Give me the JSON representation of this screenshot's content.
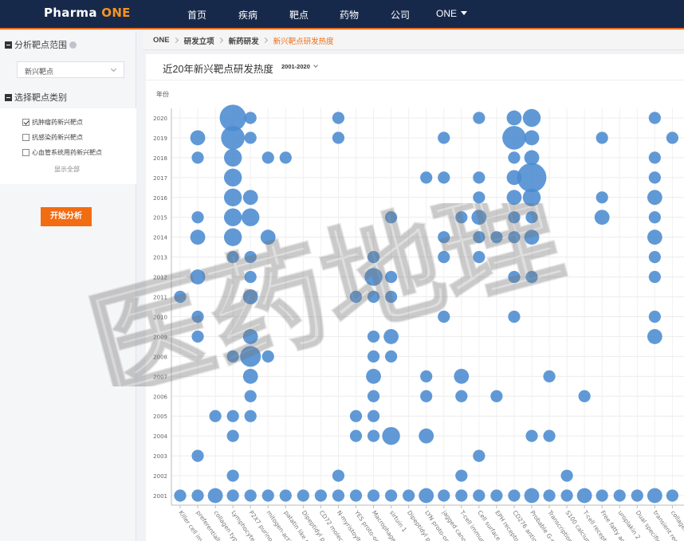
{
  "nav": {
    "logo_main": "Pharma ",
    "logo_accent": "ONE",
    "items": [
      "首页",
      "疾病",
      "靶点",
      "药物",
      "公司",
      "ONE"
    ]
  },
  "sidebar": {
    "scope_title": "分析靶点范围",
    "select_value": "新兴靶点",
    "category_title": "选择靶点类别",
    "options": [
      {
        "label": "抗肿瘤药新兴靶点",
        "checked": true
      },
      {
        "label": "抗感染药新兴靶点",
        "checked": false
      },
      {
        "label": "心血管系统用药新兴靶点",
        "checked": false
      }
    ],
    "show_all": "显示全部",
    "start_button": "开始分析"
  },
  "breadcrumb": [
    "ONE",
    "研发立项",
    "新药研发",
    "新兴靶点研发热度"
  ],
  "card": {
    "title": "近20年新兴靶点研发热度",
    "year_range": "2001-2020",
    "y_axis_name": "年份"
  },
  "watermark": "医药地理",
  "colors": {
    "navy": "#17294b",
    "orange": "#f26c12",
    "bubble": "#4a8bd0"
  },
  "chart_data": {
    "type": "scatter",
    "x_axis_name": "",
    "y_axis_name": "年份",
    "years": [
      "2001",
      "2002",
      "2003",
      "2004",
      "2005",
      "2006",
      "2007",
      "2008",
      "2009",
      "2010",
      "2011",
      "2012",
      "2013",
      "2014",
      "2015",
      "2016",
      "2017",
      "2018",
      "2019",
      "2020"
    ],
    "targets": [
      "Killer cell immu...",
      "preferentially e...",
      "collagen type I...",
      "Lymphocyte act...",
      "P2X7 purinocep...",
      "mitogen-activat...",
      "patatin like pho...",
      "Dipeptidyl pept...",
      "CD72 molecule",
      "N-myristoyltran...",
      "YES proto-onco...",
      "Macrophage-st...",
      "sirtuin 1",
      "Dipeptidyl pept...",
      "LYN proto-onco...",
      "jagged canonic...",
      "T-cell immune...",
      "Cell surface gly...",
      "EPH receptor A...",
      "CD276 antigen",
      "Probable G-pro...",
      "Transcription fa...",
      "S100 calcium bi...",
      "T-cell receptor...",
      "Free fatty acid r...",
      "uroplakin 2",
      "Dual specificity...",
      "transient recept...",
      "collagen type..."
    ],
    "points": [
      {
        "target": 0,
        "year": "2001",
        "size": 2
      },
      {
        "target": 0,
        "year": "2011",
        "size": 2
      },
      {
        "target": 1,
        "year": "2001",
        "size": 2
      },
      {
        "target": 1,
        "year": "2003",
        "size": 2
      },
      {
        "target": 1,
        "year": "2009",
        "size": 2
      },
      {
        "target": 1,
        "year": "2010",
        "size": 2
      },
      {
        "target": 1,
        "year": "2012",
        "size": 3
      },
      {
        "target": 1,
        "year": "2014",
        "size": 3
      },
      {
        "target": 1,
        "year": "2015",
        "size": 2
      },
      {
        "target": 1,
        "year": "2018",
        "size": 2
      },
      {
        "target": 1,
        "year": "2019",
        "size": 3
      },
      {
        "target": 2,
        "year": "2001",
        "size": 3
      },
      {
        "target": 2,
        "year": "2005",
        "size": 2
      },
      {
        "target": 3,
        "year": "2001",
        "size": 2
      },
      {
        "target": 3,
        "year": "2002",
        "size": 2
      },
      {
        "target": 3,
        "year": "2004",
        "size": 2
      },
      {
        "target": 3,
        "year": "2005",
        "size": 2
      },
      {
        "target": 3,
        "year": "2008",
        "size": 2
      },
      {
        "target": 3,
        "year": "2013",
        "size": 2
      },
      {
        "target": 3,
        "year": "2014",
        "size": 4
      },
      {
        "target": 3,
        "year": "2015",
        "size": 4
      },
      {
        "target": 3,
        "year": "2016",
        "size": 4
      },
      {
        "target": 3,
        "year": "2017",
        "size": 4
      },
      {
        "target": 3,
        "year": "2018",
        "size": 4
      },
      {
        "target": 3,
        "year": "2019",
        "size": 6
      },
      {
        "target": 3,
        "year": "2020",
        "size": 7
      },
      {
        "target": 4,
        "year": "2001",
        "size": 2
      },
      {
        "target": 4,
        "year": "2005",
        "size": 2
      },
      {
        "target": 4,
        "year": "2006",
        "size": 2
      },
      {
        "target": 4,
        "year": "2007",
        "size": 3
      },
      {
        "target": 4,
        "year": "2008",
        "size": 5
      },
      {
        "target": 4,
        "year": "2009",
        "size": 3
      },
      {
        "target": 4,
        "year": "2011",
        "size": 3
      },
      {
        "target": 4,
        "year": "2012",
        "size": 2
      },
      {
        "target": 4,
        "year": "2013",
        "size": 2
      },
      {
        "target": 4,
        "year": "2015",
        "size": 4
      },
      {
        "target": 4,
        "year": "2016",
        "size": 3
      },
      {
        "target": 4,
        "year": "2019",
        "size": 2
      },
      {
        "target": 4,
        "year": "2020",
        "size": 2
      },
      {
        "target": 5,
        "year": "2001",
        "size": 2
      },
      {
        "target": 5,
        "year": "2008",
        "size": 2
      },
      {
        "target": 5,
        "year": "2014",
        "size": 3
      },
      {
        "target": 5,
        "year": "2018",
        "size": 2
      },
      {
        "target": 6,
        "year": "2001",
        "size": 2
      },
      {
        "target": 6,
        "year": "2018",
        "size": 2
      },
      {
        "target": 7,
        "year": "2001",
        "size": 2
      },
      {
        "target": 8,
        "year": "2001",
        "size": 2
      },
      {
        "target": 9,
        "year": "2001",
        "size": 2
      },
      {
        "target": 9,
        "year": "2002",
        "size": 2
      },
      {
        "target": 9,
        "year": "2019",
        "size": 2
      },
      {
        "target": 9,
        "year": "2020",
        "size": 2
      },
      {
        "target": 10,
        "year": "2001",
        "size": 2
      },
      {
        "target": 10,
        "year": "2004",
        "size": 2
      },
      {
        "target": 10,
        "year": "2005",
        "size": 2
      },
      {
        "target": 10,
        "year": "2011",
        "size": 2
      },
      {
        "target": 11,
        "year": "2001",
        "size": 2
      },
      {
        "target": 11,
        "year": "2004",
        "size": 2
      },
      {
        "target": 11,
        "year": "2005",
        "size": 2
      },
      {
        "target": 11,
        "year": "2006",
        "size": 2
      },
      {
        "target": 11,
        "year": "2007",
        "size": 3
      },
      {
        "target": 11,
        "year": "2008",
        "size": 2
      },
      {
        "target": 11,
        "year": "2009",
        "size": 2
      },
      {
        "target": 11,
        "year": "2011",
        "size": 2
      },
      {
        "target": 11,
        "year": "2012",
        "size": 4
      },
      {
        "target": 11,
        "year": "2013",
        "size": 2
      },
      {
        "target": 12,
        "year": "2001",
        "size": 2
      },
      {
        "target": 12,
        "year": "2004",
        "size": 4
      },
      {
        "target": 12,
        "year": "2008",
        "size": 2
      },
      {
        "target": 12,
        "year": "2009",
        "size": 3
      },
      {
        "target": 12,
        "year": "2011",
        "size": 2
      },
      {
        "target": 12,
        "year": "2012",
        "size": 2
      },
      {
        "target": 12,
        "year": "2015",
        "size": 2
      },
      {
        "target": 13,
        "year": "2001",
        "size": 2
      },
      {
        "target": 14,
        "year": "2001",
        "size": 3
      },
      {
        "target": 14,
        "year": "2004",
        "size": 3
      },
      {
        "target": 14,
        "year": "2006",
        "size": 2
      },
      {
        "target": 14,
        "year": "2007",
        "size": 2
      },
      {
        "target": 14,
        "year": "2017",
        "size": 2
      },
      {
        "target": 15,
        "year": "2001",
        "size": 2
      },
      {
        "target": 15,
        "year": "2010",
        "size": 2
      },
      {
        "target": 15,
        "year": "2013",
        "size": 2
      },
      {
        "target": 15,
        "year": "2014",
        "size": 2
      },
      {
        "target": 15,
        "year": "2017",
        "size": 2
      },
      {
        "target": 15,
        "year": "2019",
        "size": 2
      },
      {
        "target": 16,
        "year": "2001",
        "size": 2
      },
      {
        "target": 16,
        "year": "2002",
        "size": 2
      },
      {
        "target": 16,
        "year": "2006",
        "size": 2
      },
      {
        "target": 16,
        "year": "2007",
        "size": 3
      },
      {
        "target": 16,
        "year": "2015",
        "size": 2
      },
      {
        "target": 17,
        "year": "2001",
        "size": 2
      },
      {
        "target": 17,
        "year": "2003",
        "size": 2
      },
      {
        "target": 17,
        "year": "2013",
        "size": 2
      },
      {
        "target": 17,
        "year": "2014",
        "size": 2
      },
      {
        "target": 17,
        "year": "2015",
        "size": 3
      },
      {
        "target": 17,
        "year": "2016",
        "size": 2
      },
      {
        "target": 17,
        "year": "2017",
        "size": 2
      },
      {
        "target": 17,
        "year": "2020",
        "size": 2
      },
      {
        "target": 18,
        "year": "2001",
        "size": 2
      },
      {
        "target": 18,
        "year": "2006",
        "size": 2
      },
      {
        "target": 18,
        "year": "2014",
        "size": 2
      },
      {
        "target": 19,
        "year": "2001",
        "size": 2
      },
      {
        "target": 19,
        "year": "2010",
        "size": 2
      },
      {
        "target": 19,
        "year": "2012",
        "size": 2
      },
      {
        "target": 19,
        "year": "2014",
        "size": 2
      },
      {
        "target": 19,
        "year": "2015",
        "size": 2
      },
      {
        "target": 19,
        "year": "2016",
        "size": 3
      },
      {
        "target": 19,
        "year": "2017",
        "size": 3
      },
      {
        "target": 19,
        "year": "2018",
        "size": 2
      },
      {
        "target": 19,
        "year": "2019",
        "size": 6
      },
      {
        "target": 19,
        "year": "2020",
        "size": 3
      },
      {
        "target": 20,
        "year": "2001",
        "size": 3
      },
      {
        "target": 20,
        "year": "2004",
        "size": 2
      },
      {
        "target": 20,
        "year": "2012",
        "size": 2
      },
      {
        "target": 20,
        "year": "2014",
        "size": 3
      },
      {
        "target": 20,
        "year": "2015",
        "size": 2
      },
      {
        "target": 20,
        "year": "2016",
        "size": 4
      },
      {
        "target": 20,
        "year": "2017",
        "size": 8
      },
      {
        "target": 20,
        "year": "2018",
        "size": 3
      },
      {
        "target": 20,
        "year": "2019",
        "size": 3
      },
      {
        "target": 20,
        "year": "2020",
        "size": 4
      },
      {
        "target": 21,
        "year": "2001",
        "size": 2
      },
      {
        "target": 21,
        "year": "2004",
        "size": 2
      },
      {
        "target": 21,
        "year": "2007",
        "size": 2
      },
      {
        "target": 22,
        "year": "2001",
        "size": 2
      },
      {
        "target": 22,
        "year": "2002",
        "size": 2
      },
      {
        "target": 23,
        "year": "2001",
        "size": 3
      },
      {
        "target": 23,
        "year": "2006",
        "size": 2
      },
      {
        "target": 24,
        "year": "2001",
        "size": 2
      },
      {
        "target": 24,
        "year": "2015",
        "size": 3
      },
      {
        "target": 24,
        "year": "2016",
        "size": 2
      },
      {
        "target": 24,
        "year": "2019",
        "size": 2
      },
      {
        "target": 25,
        "year": "2001",
        "size": 2
      },
      {
        "target": 26,
        "year": "2001",
        "size": 2
      },
      {
        "target": 27,
        "year": "2001",
        "size": 3
      },
      {
        "target": 27,
        "year": "2009",
        "size": 3
      },
      {
        "target": 27,
        "year": "2010",
        "size": 2
      },
      {
        "target": 27,
        "year": "2012",
        "size": 2
      },
      {
        "target": 27,
        "year": "2013",
        "size": 2
      },
      {
        "target": 27,
        "year": "2014",
        "size": 3
      },
      {
        "target": 27,
        "year": "2015",
        "size": 2
      },
      {
        "target": 27,
        "year": "2016",
        "size": 3
      },
      {
        "target": 27,
        "year": "2017",
        "size": 2
      },
      {
        "target": 27,
        "year": "2018",
        "size": 2
      },
      {
        "target": 27,
        "year": "2020",
        "size": 2
      },
      {
        "target": 28,
        "year": "2001",
        "size": 2
      },
      {
        "target": 28,
        "year": "2019",
        "size": 2
      }
    ]
  }
}
